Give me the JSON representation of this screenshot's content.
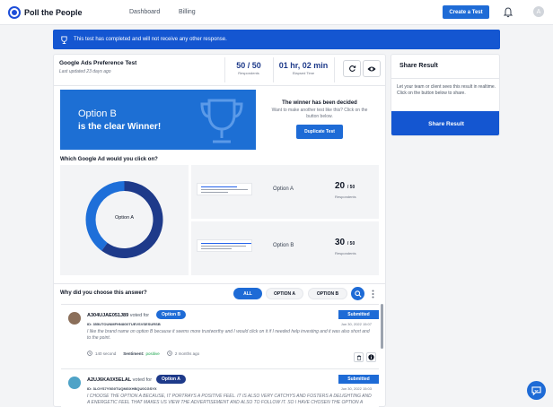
{
  "app": {
    "brand": "Poll the People"
  },
  "nav": {
    "dashboard": "Dashboard",
    "billing": "Billing",
    "create_test": "Create a Test",
    "avatar_initial": "A"
  },
  "banner": {
    "text": "This test has completed and will not receive any other response.",
    "icon": "trophy-icon"
  },
  "test": {
    "title": "Google Ads Preference Test",
    "updated": "Last updated 23 days ago",
    "respondents_value": "50 / 50",
    "respondents_label": "Respondents",
    "elapsed_value": "01 hr, 02 min",
    "elapsed_label": "Elapsed Time"
  },
  "winner": {
    "line1": "Option B",
    "line2": "is the clear Winner!",
    "decided_title": "The winner has been decided",
    "decided_sub": "Want to make another test like this? Click on the button below.",
    "duplicate_button": "Duplicate Test"
  },
  "results": {
    "question": "Which Google Ad would you click on?",
    "pie_label": "Option A",
    "options": [
      {
        "name": "Option A",
        "count": "20",
        "total": "/ 50",
        "label": "Respondents"
      },
      {
        "name": "Option B",
        "count": "30",
        "total": "/ 50",
        "label": "Respondents"
      }
    ]
  },
  "chart_data": {
    "type": "pie",
    "categories": [
      "Option A",
      "Option B"
    ],
    "values": [
      20,
      30
    ],
    "colors": [
      "#1e6fd9",
      "#1e3a8a"
    ]
  },
  "answers": {
    "question": "Why did you choose this answer?",
    "filters": [
      "ALL",
      "OPTION A",
      "OPTION B"
    ],
    "responses": [
      {
        "name": "A304UJAE051J89",
        "voted_for": "voted for",
        "option": "Option B",
        "id": "ID: 355UTOUNMFHN8G0TUEVSVSESURSB",
        "date": "Jun 30, 2022 15:07",
        "status": "Submitted",
        "text": "I like the brand name on option B because it seems more trustworthy and I would click on it if I needed help investing and it was also short and to the point.",
        "duration": "140 second",
        "sentiment_label": "Sentiment:",
        "sentiment": "positive",
        "ago": "2 months ago"
      },
      {
        "name": "A2UJ6KA0X5ELAL",
        "voted_for": "voted for",
        "option": "Option A",
        "id": "ID: 3LOYS7Y5G0TUQMGXHBQU0CGSYX",
        "date": "Jun 30, 2022 15:03",
        "status": "Submitted",
        "text": "I CHOOSE THE OPTION A BECAUSE, IT PORTRAYS A POSITIVE FEEL. IT IS ALSO VERY CATCHYS AND FOSTERS A DELIGHTING AND A ENERGETIC FEEL THAT MAKES US VIEW THE ADVERTISEMENT AND ALSO TO FOLLOW IT. SO I HAVE CHOSEN THE OPTION A"
      }
    ]
  },
  "share": {
    "title": "Share Result",
    "text": "Let your team or client sees this result in realtime. Click on the button below to share.",
    "button": "Share Result"
  }
}
